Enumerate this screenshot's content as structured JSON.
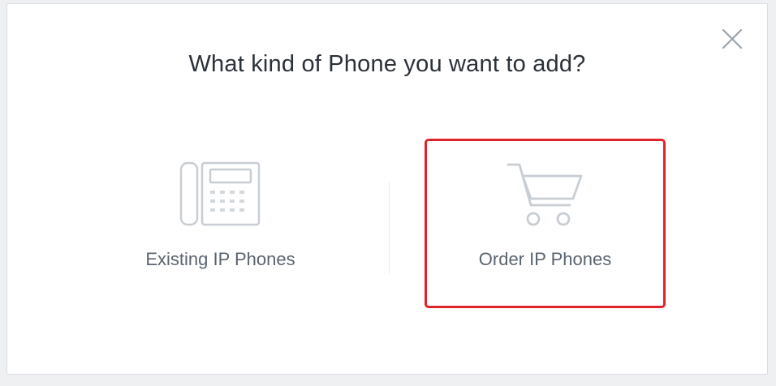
{
  "dialog": {
    "title": "What kind of Phone you want to add?",
    "close_icon": "close-icon"
  },
  "options": [
    {
      "label": "Existing IP Phones",
      "icon": "desk-phone-icon",
      "selected": false
    },
    {
      "label": "Order IP Phones",
      "icon": "shopping-cart-icon",
      "selected": true
    }
  ],
  "colors": {
    "highlight_border": "#e0242b",
    "icon_stroke": "#c8ced4",
    "title_text": "#2b3138",
    "label_text": "#5a6470"
  }
}
